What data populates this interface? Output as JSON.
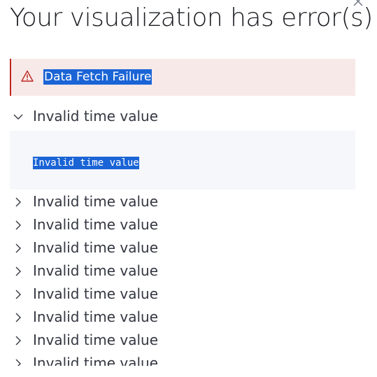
{
  "modal": {
    "title": "Your visualization has error(s)",
    "close_icon": "close-icon"
  },
  "callout": {
    "icon": "warning-icon",
    "title": "Data Fetch Failure",
    "colors": {
      "background": "#f8e9e9",
      "border": "#bd271e",
      "selection": "#1a64d6"
    }
  },
  "errors": {
    "expanded": {
      "label": "Invalid time value",
      "code": "Invalid time value",
      "icon": "chevron-down-icon"
    },
    "collapsed": [
      {
        "label": "Invalid time value",
        "icon": "chevron-right-icon"
      },
      {
        "label": "Invalid time value",
        "icon": "chevron-right-icon"
      },
      {
        "label": "Invalid time value",
        "icon": "chevron-right-icon"
      },
      {
        "label": "Invalid time value",
        "icon": "chevron-right-icon"
      },
      {
        "label": "Invalid time value",
        "icon": "chevron-right-icon"
      },
      {
        "label": "Invalid time value",
        "icon": "chevron-right-icon"
      },
      {
        "label": "Invalid time value",
        "icon": "chevron-right-icon"
      },
      {
        "label": "Invalid time value",
        "icon": "chevron-right-icon"
      }
    ]
  }
}
